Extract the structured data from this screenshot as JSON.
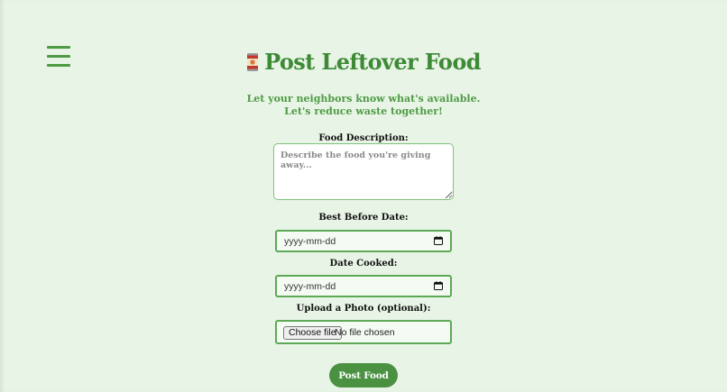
{
  "colors": {
    "background": "#e8f5e6",
    "accent": "#3e8a37",
    "accent_light": "#4f9a45",
    "button": "#4a9142"
  },
  "nav": {
    "menu_icon": "hamburger-menu-icon"
  },
  "header": {
    "title_icon": "canned-food-icon",
    "title": "Post Leftover Food",
    "subtitle": "Let your neighbors know what's available. Let's reduce waste together!"
  },
  "form": {
    "description": {
      "label": "Food Description:",
      "placeholder": "Describe the food you're giving away...",
      "value": ""
    },
    "best_before": {
      "label": "Best Before Date:",
      "value": "yyyy-mm-dd",
      "icon": "calendar-icon"
    },
    "date_cooked": {
      "label": "Date Cooked:",
      "value": "yyyy-mm-dd",
      "icon": "calendar-icon"
    },
    "photo": {
      "label": "Upload a Photo (optional):",
      "button_label": "Choose file",
      "status": "No file chosen"
    },
    "submit_label": "Post Food"
  }
}
